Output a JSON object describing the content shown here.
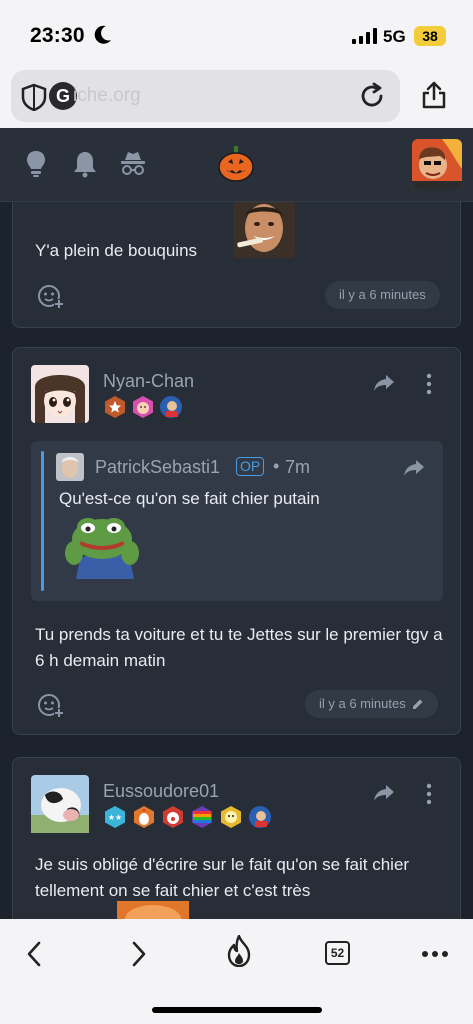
{
  "status": {
    "time": "23:30",
    "network": "5G",
    "battery": "38"
  },
  "browser": {
    "url": "iche.org",
    "shield_badge": "G",
    "tab_count": "52"
  },
  "header": {
    "icons": [
      "lightbulb-icon",
      "bell-icon",
      "incognito-icon"
    ],
    "logo": "pumpkin-logo"
  },
  "posts": [
    {
      "text": "Y'a plein de bouquins",
      "timestamp": "il y a 6 minutes"
    },
    {
      "username": "Nyan-Chan",
      "quote": {
        "username": "PatrickSebasti1",
        "op_label": "OP",
        "time": "7m",
        "text": "Qu'est-ce qu'on se fait chier putain"
      },
      "text": "Tu prends ta voiture et tu te Jettes sur le premier tgv a 6 h demain matin",
      "timestamp": "il y a 6 minutes"
    },
    {
      "username": "Eussoudore01",
      "text": "Je suis obligé d'écrire sur le fait qu'on se fait chier tellement on se fait chier et c'est très"
    }
  ],
  "colors": {
    "background": "#1d232c",
    "card": "#272e38",
    "accent": "#4a9be0",
    "battery": "#f2cc3b"
  }
}
